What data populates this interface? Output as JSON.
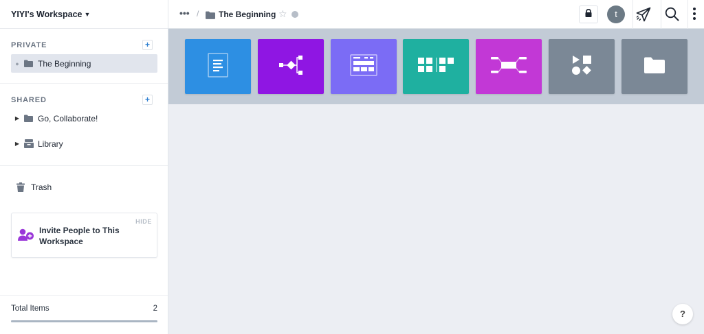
{
  "workspace": {
    "name": "YIYI's Workspace"
  },
  "sidebar": {
    "private_title": "PRIVATE",
    "private_items": [
      {
        "label": "The Beginning"
      }
    ],
    "shared_title": "SHARED",
    "shared_items": [
      {
        "label": "Go, Collaborate!"
      },
      {
        "label": "Library"
      }
    ],
    "trash_label": "Trash",
    "invite": {
      "hide_label": "HIDE",
      "text": "Invite People to This Workspace"
    },
    "total": {
      "label": "Total Items",
      "count": "2"
    }
  },
  "topbar": {
    "breadcrumb_more": "•••",
    "breadcrumb_sep": "/",
    "breadcrumb_title": "The Beginning",
    "star_glyph": "☆",
    "avatar_initial": "t"
  },
  "tiles": [
    {
      "name": "document-tile",
      "icon": "document-icon",
      "color": "#2d8fe3"
    },
    {
      "name": "flow-tile",
      "icon": "flow-diagram-icon",
      "color": "#8f16e3"
    },
    {
      "name": "table-tile",
      "icon": "table-icon",
      "color": "#7b6cf5"
    },
    {
      "name": "board-tile",
      "icon": "kanban-board-icon",
      "color": "#1fb0a0"
    },
    {
      "name": "mindmap-tile",
      "icon": "mindmap-icon",
      "color": "#c238d6"
    },
    {
      "name": "shapes-tile",
      "icon": "shapes-icon",
      "color": "#7b8896"
    },
    {
      "name": "folder-tile",
      "icon": "folder-icon",
      "color": "#7b8896"
    }
  ],
  "help": {
    "label": "?"
  },
  "colors": {
    "accent": "#2f80d1",
    "selected_bg": "#e1e5ed",
    "band": "#c2cbd6"
  }
}
